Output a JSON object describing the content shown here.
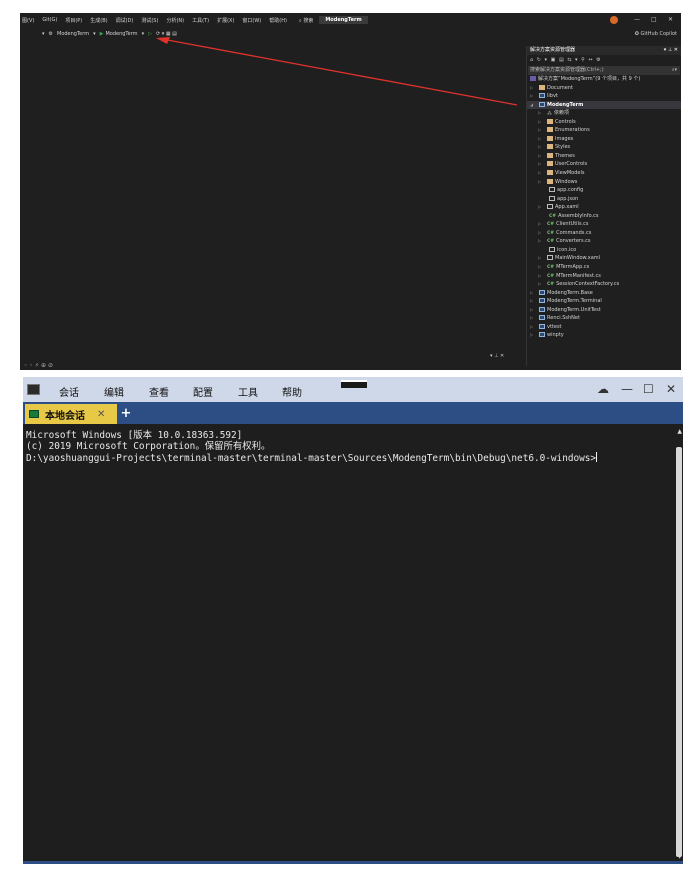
{
  "vs": {
    "menu": [
      "图(V)",
      "Git(G)",
      "项目(P)",
      "生成(B)",
      "调试(D)",
      "测试(S)",
      "分析(N)",
      "工具(T)",
      "扩展(X)",
      "窗口(W)",
      "帮助(H)"
    ],
    "search_label": "搜索",
    "solution_name": "ModengTerm",
    "user_initials": "SY",
    "copilot_label": "GitHub Copilot",
    "toolbar": {
      "startup_project": "ModengTerm",
      "debug_target": "ModengTerm"
    },
    "solution_explorer": {
      "title": "解决方案资源管理器",
      "search_placeholder": "搜索解决方案资源管理器(Ctrl+;)",
      "solution_row": "解决方案“ModengTerm”(9 个项目，共 9 个)",
      "items": [
        {
          "label": "Document",
          "icon": "folder-icon",
          "indent": 1,
          "expand": "▷"
        },
        {
          "label": "libvt",
          "icon": "project-icon",
          "indent": 1,
          "expand": "▷"
        },
        {
          "label": "ModengTerm",
          "icon": "project-icon",
          "indent": 1,
          "expand": "◢",
          "selected": true
        },
        {
          "label": "依赖项",
          "icon": "dependencies-icon",
          "indent": 2,
          "expand": "▷"
        },
        {
          "label": "Controls",
          "icon": "folder-icon",
          "indent": 2,
          "expand": "▷"
        },
        {
          "label": "Enumerations",
          "icon": "folder-icon",
          "indent": 2,
          "expand": "▷"
        },
        {
          "label": "Images",
          "icon": "folder-icon",
          "indent": 2,
          "expand": "▷"
        },
        {
          "label": "Styles",
          "icon": "folder-icon",
          "indent": 2,
          "expand": "▷"
        },
        {
          "label": "Themes",
          "icon": "folder-icon",
          "indent": 2,
          "expand": "▷"
        },
        {
          "label": "UserControls",
          "icon": "folder-icon",
          "indent": 2,
          "expand": "▷"
        },
        {
          "label": "ViewModels",
          "icon": "folder-icon",
          "indent": 2,
          "expand": "▷"
        },
        {
          "label": "Windows",
          "icon": "folder-icon",
          "indent": 2,
          "expand": "▷"
        },
        {
          "label": "app.config",
          "icon": "file-icon",
          "indent": 3,
          "expand": ""
        },
        {
          "label": "app.json",
          "icon": "file-icon",
          "indent": 3,
          "expand": ""
        },
        {
          "label": "App.xaml",
          "icon": "xaml-icon",
          "indent": 2,
          "expand": "▷"
        },
        {
          "label": "AssemblyInfo.cs",
          "icon": "csharp-icon",
          "indent": 3,
          "expand": ""
        },
        {
          "label": "ClientUtils.cs",
          "icon": "csharp-icon",
          "indent": 2,
          "expand": "▷"
        },
        {
          "label": "Commands.cs",
          "icon": "csharp-icon",
          "indent": 2,
          "expand": "▷"
        },
        {
          "label": "Converters.cs",
          "icon": "csharp-icon",
          "indent": 2,
          "expand": "▷"
        },
        {
          "label": "icon.ico",
          "icon": "file-icon",
          "indent": 3,
          "expand": ""
        },
        {
          "label": "MainWindow.xaml",
          "icon": "xaml-icon",
          "indent": 2,
          "expand": "▷"
        },
        {
          "label": "MTermApp.cs",
          "icon": "csharp-icon",
          "indent": 2,
          "expand": "▷"
        },
        {
          "label": "MTermManifest.cs",
          "icon": "csharp-icon",
          "indent": 2,
          "expand": "▷"
        },
        {
          "label": "SessionContextFactory.cs",
          "icon": "csharp-icon",
          "indent": 2,
          "expand": "▷"
        },
        {
          "label": "ModengTerm.Base",
          "icon": "project-icon",
          "indent": 1,
          "expand": "▷"
        },
        {
          "label": "ModengTerm.Terminal",
          "icon": "project-icon",
          "indent": 1,
          "expand": "▷"
        },
        {
          "label": "ModengTerm.UnitTest",
          "icon": "project-icon",
          "indent": 1,
          "expand": "▷"
        },
        {
          "label": "Renci.SshNet",
          "icon": "project-icon",
          "indent": 1,
          "expand": "▷"
        },
        {
          "label": "vttest",
          "icon": "project-icon",
          "indent": 1,
          "expand": "▷"
        },
        {
          "label": "winpty",
          "icon": "project-icon",
          "indent": 1,
          "expand": "▷"
        }
      ]
    },
    "arrow_color": "#e0322c"
  },
  "terminal": {
    "menu": [
      "会话",
      "编辑",
      "查看",
      "配置",
      "工具",
      "帮助"
    ],
    "tab_label": "本地会话",
    "tab_close": "✕",
    "add_tab": "+",
    "lines": [
      "Microsoft Windows [版本 10.0.18363.592]",
      "(c) 2019 Microsoft Corporation。保留所有权利。",
      "",
      "D:\\yaoshuanggui-Projects\\terminal-master\\terminal-master\\Sources\\ModengTerm\\bin\\Debug\\net6.0-windows>"
    ],
    "colors": {
      "menubar": "#cfd8e8",
      "tabbar": "#2d4e84",
      "active_tab": "#e8c847",
      "background": "#1e1e1e"
    }
  }
}
